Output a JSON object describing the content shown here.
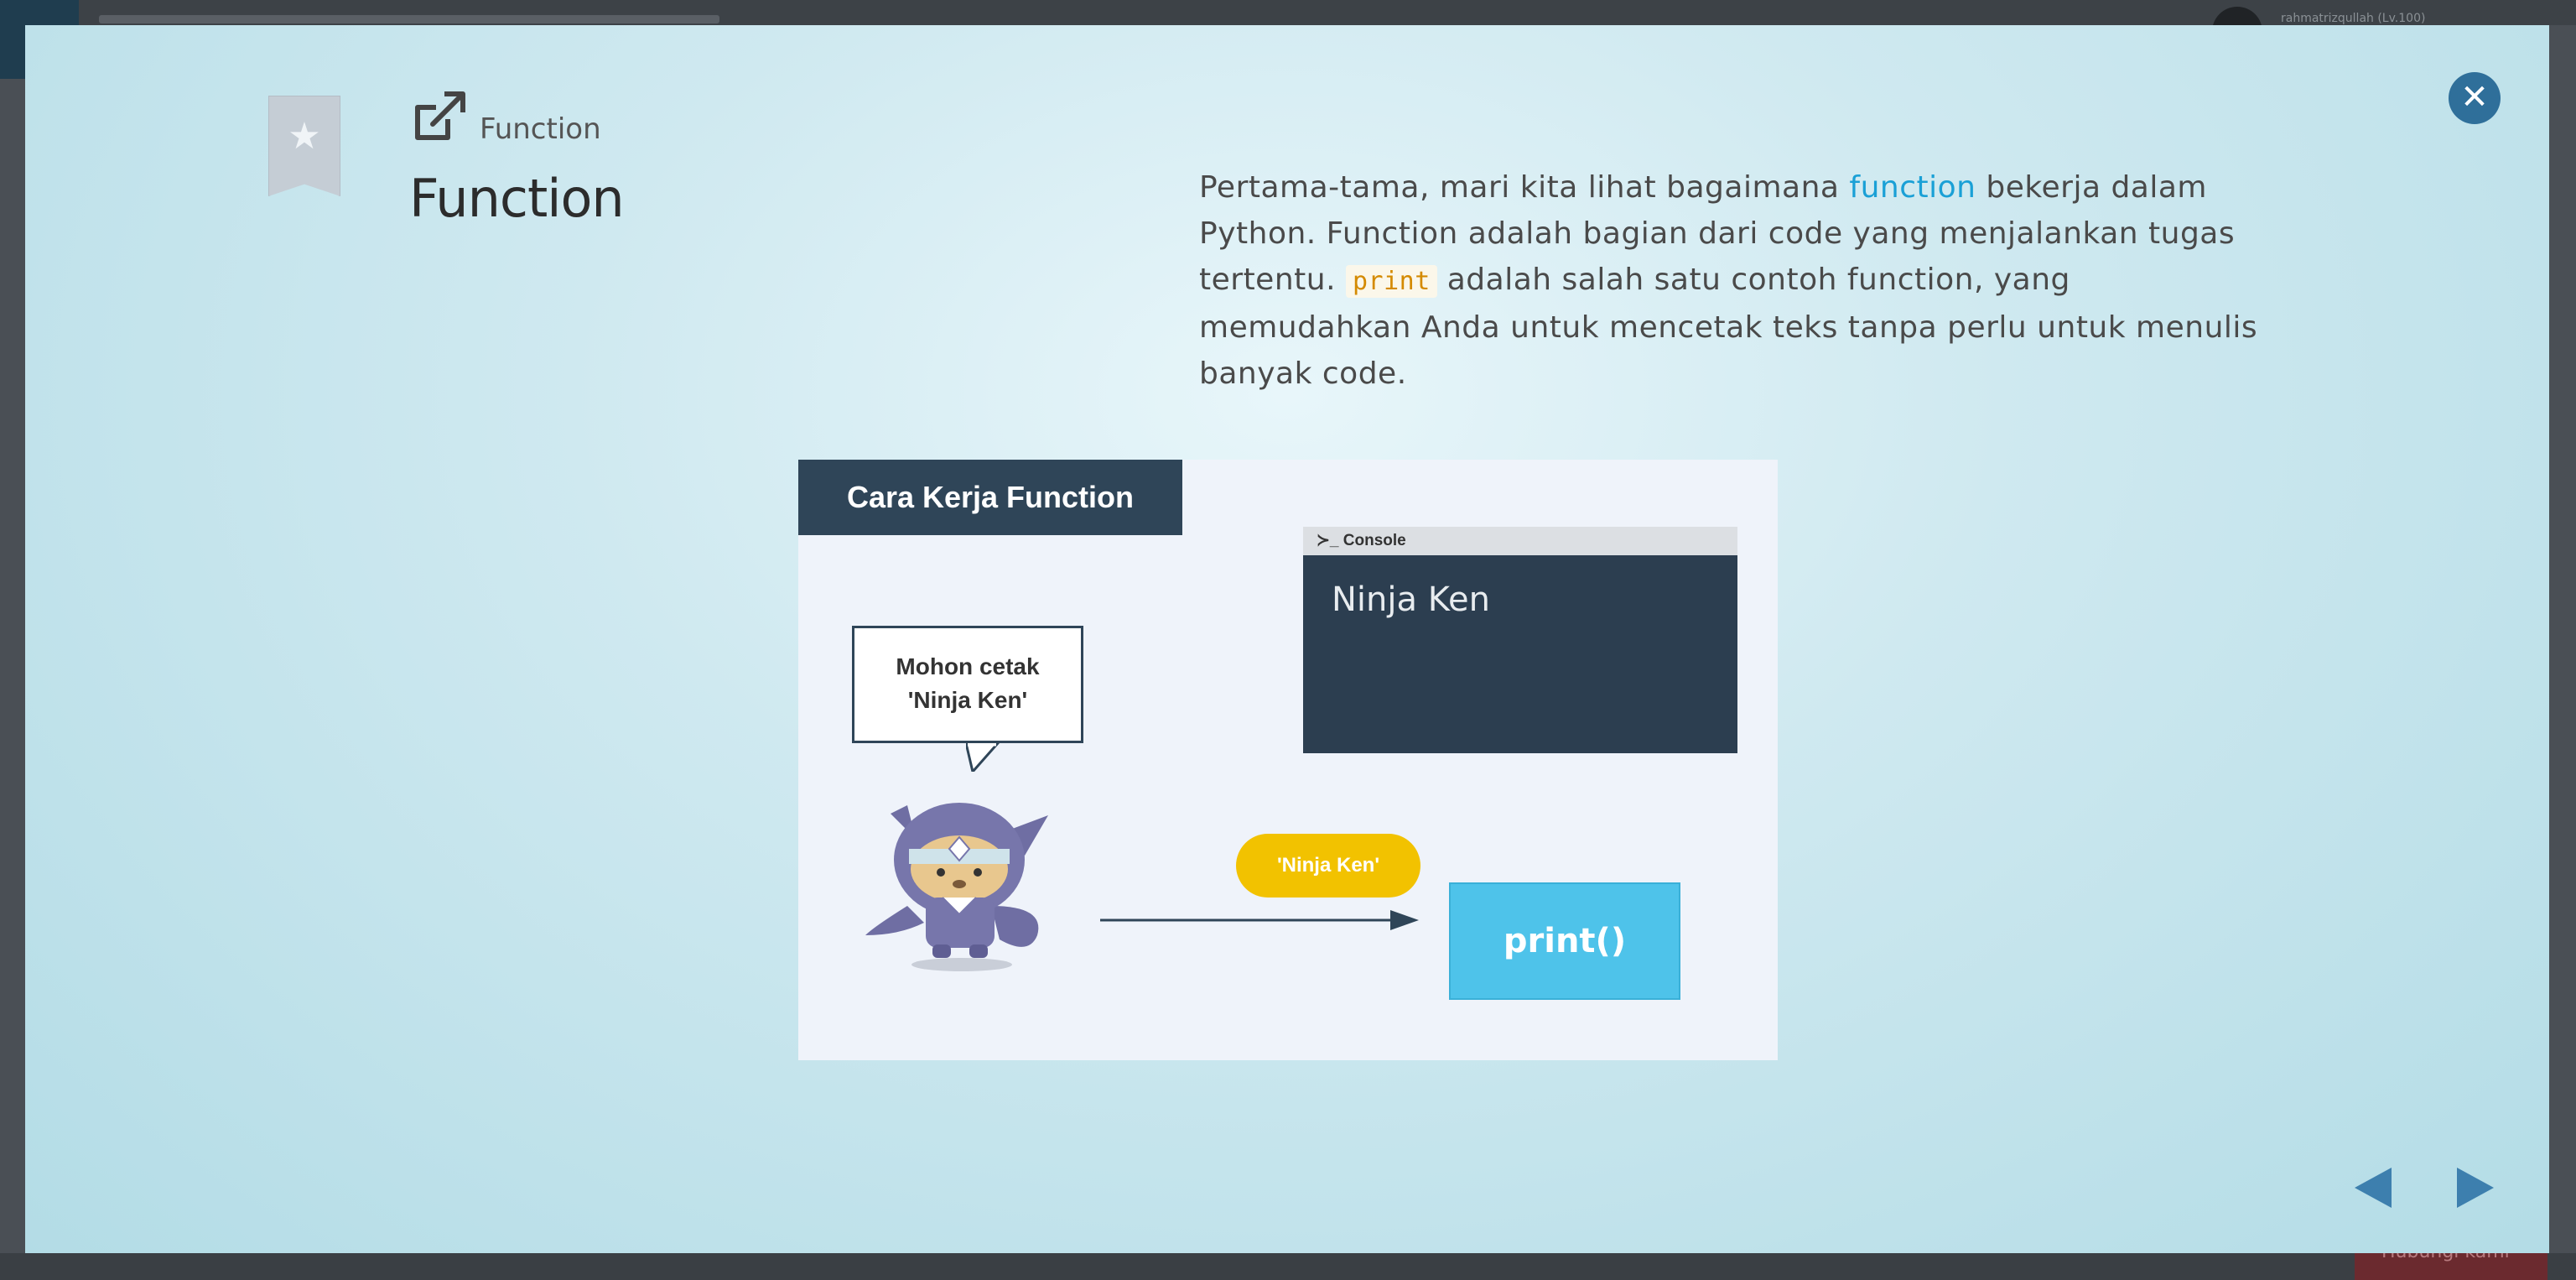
{
  "background": {
    "user_label": "rahmatrizqullah (Lv.100)",
    "bottom_button_label": "Hubungi kami"
  },
  "slide": {
    "breadcrumb": "Function",
    "title": "Function",
    "description": {
      "part1": "Pertama-tama, mari kita lihat bagaimana ",
      "keyword": "function",
      "part2": " bekerja dalam Python. Function adalah bagian dari code yang menjalankan tugas tertentu. ",
      "code": "print",
      "part3": " adalah salah satu contoh function, yang memudahkan Anda untuk mencetak teks tanpa perlu untuk menulis banyak code."
    }
  },
  "figure": {
    "header": "Cara Kerja Function",
    "console_label": "Console",
    "console_output": "Ninja Ken",
    "speech_line1": "Mohon cetak",
    "speech_line2": "'Ninja Ken'",
    "argument": "'Ninja Ken'",
    "function_call": "print()"
  },
  "icons": {
    "bookmark": "star-bookmark-icon",
    "external": "external-link-icon",
    "close": "close-icon",
    "prev": "triangle-left-icon",
    "next": "triangle-right-icon"
  },
  "colors": {
    "keyword": "#1aa0d6",
    "code": "#d48a00",
    "close_button": "#2f6f9a",
    "console_bg": "#2c3e50",
    "function_box": "#4ec3ea",
    "argument_pill": "#f2c200"
  }
}
